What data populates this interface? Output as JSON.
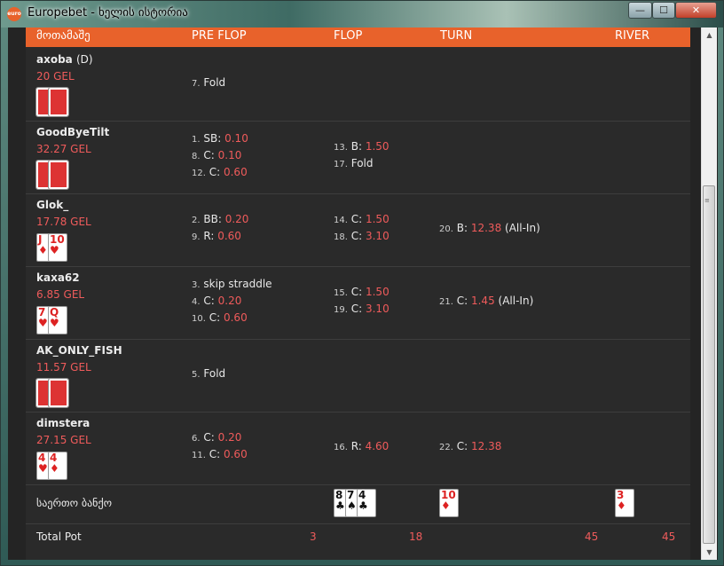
{
  "window": {
    "title": "Europebet - ხელის ისტორია",
    "icon_label": "euro",
    "controls": {
      "minimize": "—",
      "maximize": "☐",
      "close": "✕"
    }
  },
  "columns": [
    "მოთამაშე",
    "PRE FLOP",
    "FLOP",
    "TURN",
    "RIVER"
  ],
  "players": [
    {
      "name": "axoba",
      "dealer": "(D)",
      "balance": "20 GEL",
      "cards": [
        {
          "back": true
        },
        {
          "back": true
        }
      ],
      "preflop": [
        {
          "n": "7.",
          "a": "Fold",
          "amt": ""
        }
      ],
      "flop": [],
      "turn": [],
      "river": []
    },
    {
      "name": "GoodByeTilt",
      "dealer": "",
      "balance": "32.27 GEL",
      "cards": [
        {
          "back": true
        },
        {
          "back": true
        }
      ],
      "preflop": [
        {
          "n": "1.",
          "a": "SB:",
          "amt": "0.10"
        },
        {
          "n": "8.",
          "a": "C:",
          "amt": "0.10"
        },
        {
          "n": "12.",
          "a": "C:",
          "amt": "0.60"
        }
      ],
      "flop": [
        {
          "n": "13.",
          "a": "B:",
          "amt": "1.50"
        },
        {
          "n": "17.",
          "a": "Fold",
          "amt": ""
        }
      ],
      "turn": [],
      "river": []
    },
    {
      "name": "Glok_",
      "dealer": "",
      "balance": "17.78 GEL",
      "cards": [
        {
          "rank": "J",
          "suit": "♦",
          "color": "red"
        },
        {
          "rank": "10",
          "suit": "♥",
          "color": "red"
        }
      ],
      "preflop": [
        {
          "n": "2.",
          "a": "BB:",
          "amt": "0.20"
        },
        {
          "n": "9.",
          "a": "R:",
          "amt": "0.60"
        }
      ],
      "flop": [
        {
          "n": "14.",
          "a": "C:",
          "amt": "1.50"
        },
        {
          "n": "18.",
          "a": "C:",
          "amt": "3.10"
        }
      ],
      "turn": [
        {
          "n": "20.",
          "a": "B:",
          "amt": "12.38",
          "tail": "(All-In)"
        }
      ],
      "river": []
    },
    {
      "name": "kaxa62",
      "dealer": "",
      "balance": "6.85 GEL",
      "cards": [
        {
          "rank": "7",
          "suit": "♥",
          "color": "red"
        },
        {
          "rank": "Q",
          "suit": "♥",
          "color": "red"
        }
      ],
      "preflop": [
        {
          "n": "3.",
          "a": "skip straddle",
          "amt": ""
        },
        {
          "n": "4.",
          "a": "C:",
          "amt": "0.20"
        },
        {
          "n": "10.",
          "a": "C:",
          "amt": "0.60"
        }
      ],
      "flop": [
        {
          "n": "15.",
          "a": "C:",
          "amt": "1.50"
        },
        {
          "n": "19.",
          "a": "C:",
          "amt": "3.10"
        }
      ],
      "turn": [
        {
          "n": "21.",
          "a": "C:",
          "amt": "1.45",
          "tail": "(All-In)"
        }
      ],
      "river": []
    },
    {
      "name": "AK_ONLY_FISH",
      "dealer": "",
      "balance": "11.57 GEL",
      "cards": [
        {
          "back": true
        },
        {
          "back": true
        }
      ],
      "preflop": [
        {
          "n": "5.",
          "a": "Fold",
          "amt": ""
        }
      ],
      "flop": [],
      "turn": [],
      "river": []
    },
    {
      "name": "dimstera",
      "dealer": "",
      "balance": "27.15 GEL",
      "cards": [
        {
          "rank": "4",
          "suit": "♥",
          "color": "red"
        },
        {
          "rank": "4",
          "suit": "♦",
          "color": "red"
        }
      ],
      "preflop": [
        {
          "n": "6.",
          "a": "C:",
          "amt": "0.20"
        },
        {
          "n": "11.",
          "a": "C:",
          "amt": "0.60"
        }
      ],
      "flop": [
        {
          "n": "16.",
          "a": "R:",
          "amt": "4.60"
        }
      ],
      "turn": [
        {
          "n": "22.",
          "a": "C:",
          "amt": "12.38"
        }
      ],
      "river": []
    }
  ],
  "community": {
    "label": "საერთო ბანქო",
    "flop": [
      {
        "rank": "8",
        "suit": "♣",
        "color": "black"
      },
      {
        "rank": "7",
        "suit": "♠",
        "color": "black"
      },
      {
        "rank": "4",
        "suit": "♣",
        "color": "black"
      }
    ],
    "turn": [
      {
        "rank": "10",
        "suit": "♦",
        "color": "red"
      }
    ],
    "river": [
      {
        "rank": "3",
        "suit": "♦",
        "color": "red"
      }
    ]
  },
  "total_pot": {
    "label": "Total Pot",
    "preflop": "3",
    "flop": "18",
    "turn": "45",
    "river": "45"
  },
  "colors": {
    "header": "#e8622b",
    "amount": "#ef5b5b",
    "background": "#2a2a2a"
  }
}
